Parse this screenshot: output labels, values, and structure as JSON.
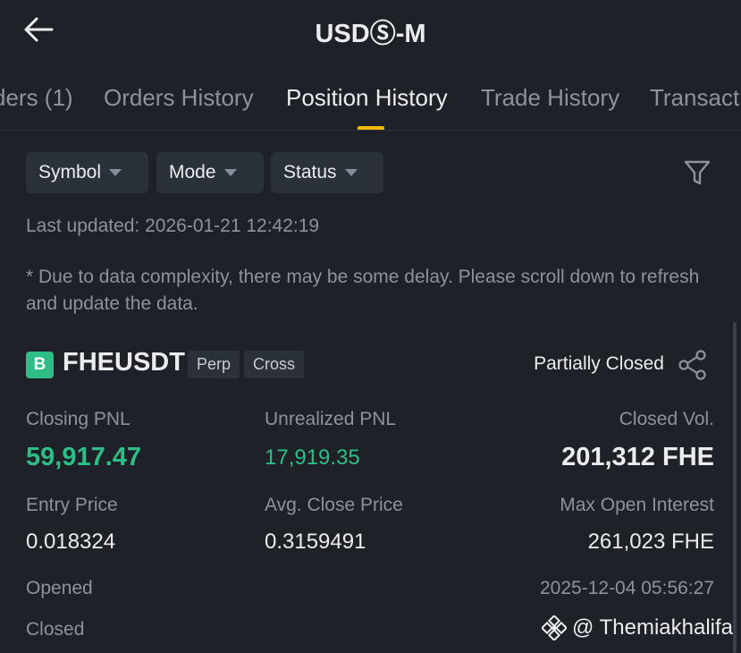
{
  "header": {
    "title": "USDⓈ-M",
    "back_icon": "arrow-left-icon"
  },
  "tabs": [
    {
      "label": "ders (1)",
      "active": false
    },
    {
      "label": "Orders History",
      "active": false
    },
    {
      "label": "Position History",
      "active": true
    },
    {
      "label": "Trade History",
      "active": false
    },
    {
      "label": "Transact",
      "active": false
    }
  ],
  "filters": {
    "symbol": "Symbol",
    "mode": "Mode",
    "status": "Status",
    "filter_icon": "funnel-icon"
  },
  "last_updated": "Last updated: 2026-01-21 12:42:19",
  "notice": "* Due to data complexity, there may be some delay. Please scroll down to refresh and update the data.",
  "position": {
    "side_badge": "B",
    "symbol": "FHEUSDT",
    "tags": [
      "Perp",
      "Cross"
    ],
    "status": "Partially Closed",
    "share_icon": "share-icon",
    "fields": {
      "closing_pnl_label": "Closing PNL",
      "closing_pnl_value": "59,917.47",
      "unrealized_pnl_label": "Unrealized PNL",
      "unrealized_pnl_value": "17,919.35",
      "closed_vol_label": "Closed Vol.",
      "closed_vol_value": "201,312 FHE",
      "entry_price_label": "Entry Price",
      "entry_price_value": "0.018324",
      "avg_close_price_label": "Avg. Close Price",
      "avg_close_price_value": "0.3159491",
      "max_open_interest_label": "Max Open Interest",
      "max_open_interest_value": "261,023 FHE",
      "opened_label": "Opened",
      "opened_value": "2025-12-04 05:56:27",
      "closed_label": "Closed"
    }
  },
  "watermark": {
    "text": "@ Themiakhalifa",
    "icon": "binance-logo-icon"
  },
  "colors": {
    "background": "#1e2127",
    "accent": "#f0b90b",
    "profit": "#2ebd85",
    "muted": "#8c939d"
  }
}
